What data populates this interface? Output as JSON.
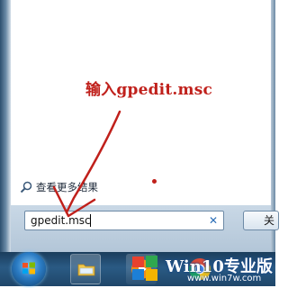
{
  "annotation": {
    "instruction": "输入gpedit.msc",
    "color": "#c0201b"
  },
  "start_menu": {
    "see_more_results": "查看更多结果",
    "see_more_icon": "magnifier-icon",
    "search": {
      "value": "gpedit.msc",
      "clear_icon": "close-icon"
    },
    "shutdown_label": "关"
  },
  "taskbar": {
    "start_icon": "windows-start-orb-icon",
    "pinned": [
      "windows-explorer-icon",
      "media-player-icon",
      "chrome-icon"
    ]
  },
  "watermark": {
    "title": "Win10专业版",
    "url": "www.win7w.com",
    "logo_icon": "windows-logo-icon"
  }
}
